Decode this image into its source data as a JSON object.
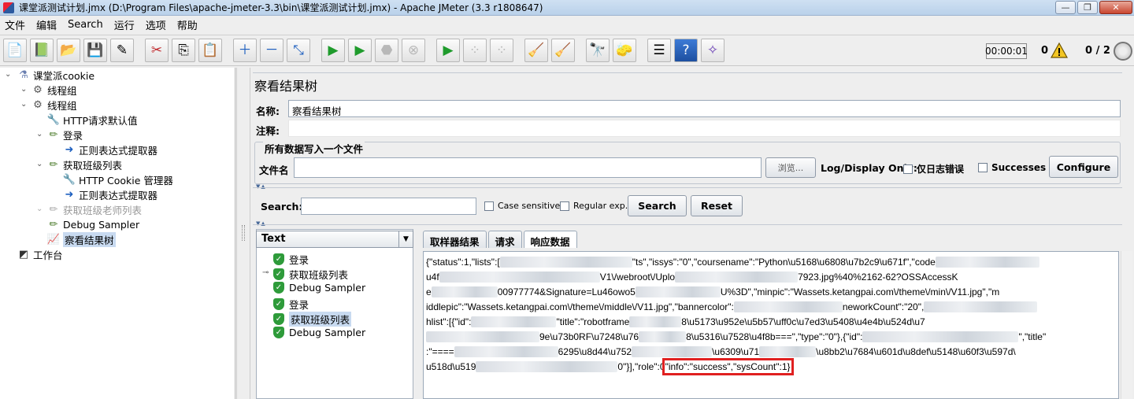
{
  "window": {
    "title": "课堂派测试计划.jmx (D:\\Program Files\\apache-jmeter-3.3\\bin\\课堂派测试计划.jmx) - Apache JMeter (3.3 r1808647)"
  },
  "menu": [
    "文件",
    "编辑",
    "Search",
    "运行",
    "选项",
    "帮助"
  ],
  "toolbar": {
    "icons": [
      "new-icon",
      "templates-icon",
      "open-icon",
      "save-icon",
      "save-as-icon",
      "cut-icon",
      "copy-icon",
      "paste-icon",
      "expand-icon",
      "collapse-icon",
      "toggle-icon",
      "start-icon",
      "start-no-pause-icon",
      "stop-icon",
      "shutdown-icon",
      "remote-start-icon",
      "remote-stop-icon",
      "remote-shutdown-icon",
      "clear-icon",
      "clear-all-icon",
      "search-icon",
      "reset-search-icon",
      "function-helper-icon",
      "help-icon",
      "log-viewer-icon"
    ],
    "timer": "00:00:01",
    "error_count": "0",
    "threads": "0 / 2"
  },
  "tree": {
    "items": [
      {
        "label": "课堂派cookie",
        "icon": "test-plan-icon"
      },
      {
        "label": "线程组",
        "icon": "thread-group-icon"
      },
      {
        "label": "线程组",
        "icon": "thread-group-icon"
      },
      {
        "label": "HTTP请求默认值",
        "icon": "config-icon"
      },
      {
        "label": "登录",
        "icon": "sampler-icon"
      },
      {
        "label": "正则表达式提取器",
        "icon": "extractor-icon"
      },
      {
        "label": "获取班级列表",
        "icon": "sampler-icon"
      },
      {
        "label": "HTTP Cookie 管理器",
        "icon": "config-icon"
      },
      {
        "label": "正则表达式提取器",
        "icon": "extractor-icon"
      },
      {
        "label": "获取班级老师列表",
        "icon": "sampler-icon"
      },
      {
        "label": "Debug Sampler",
        "icon": "sampler-icon"
      },
      {
        "label": "察看结果树",
        "icon": "listener-icon"
      },
      {
        "label": "工作台",
        "icon": "workbench-icon"
      }
    ]
  },
  "panel": {
    "title": "察看结果树",
    "name_label": "名称:",
    "name_value": "察看结果树",
    "comment_label": "注释:",
    "file_group_title": "所有数据写入一个文件",
    "filename_label": "文件名",
    "browse_label": "浏览...",
    "log_display_label": "Log/Display Only:",
    "errors_only_label": "仅日志错误",
    "successes_label": "Successes",
    "configure_label": "Configure",
    "search_label": "Search:",
    "case_sensitive_label": "Case sensitive",
    "regular_exp_label": "Regular exp.",
    "search_button": "Search",
    "reset_button": "Reset",
    "renderer": "Text",
    "samples": [
      "登录",
      "获取班级列表",
      "Debug Sampler",
      "登录",
      "获取班级列表",
      "Debug Sampler"
    ],
    "tabs": [
      "取样器结果",
      "请求",
      "响应数据"
    ],
    "response_lines": [
      {
        "a": "{\"status\":1,\"lists\":[",
        "b": "\"ts\",\"issys\":\"0\",\"coursename\":\"Python\\u5168\\u6808\\u7b2c9\\u671f\",\"code"
      },
      {
        "a": "u4f",
        "b": "V1\\/webroot\\/Uplo",
        "c": "7923.jpg%40%2162-62?OSSAccessK"
      },
      {
        "a": "e",
        "b": "00977774&Signature=Lu46owo5",
        "c": "U%3D\",\"minpic\":\"Wassets.ketangpai.com\\/theme\\/min\\/V11.jpg\",\"m"
      },
      {
        "a": "iddlepic\":\"Wassets.ketangpai.com\\/theme\\/middle\\/V11.jpg\",\"bannercolor\":",
        "c": "neworkCount\":\"20\","
      },
      {
        "a": "hlist\":[{\"id\":",
        "b": "\"title\":\"robotframe",
        "c": "8\\u5173\\u952e\\u5b57\\uff0c\\u7ed3\\u5408\\u4e4b\\u524d\\u7"
      },
      {
        "a": "",
        "b": "9e\\u73b0RF\\u7248\\u76",
        "c": "8\\u5316\\u7528\\u4f8b===\",\"type\":\"0\"},{\"id\":",
        "d": "\",\"title\""
      },
      {
        "a": ":\"====",
        "b": "6295\\u8d44\\u752",
        "c": "\\u6309\\u71",
        "d": "\\u8bb2\\u7684\\u601d\\u8def\\u5148\\u60f3\\u597d\\"
      },
      {
        "a": "u518d\\u519",
        "b": "0\"}],\"role\":0",
        "c": "\"info\":\"success\",\"sysCount\":1}"
      }
    ]
  }
}
